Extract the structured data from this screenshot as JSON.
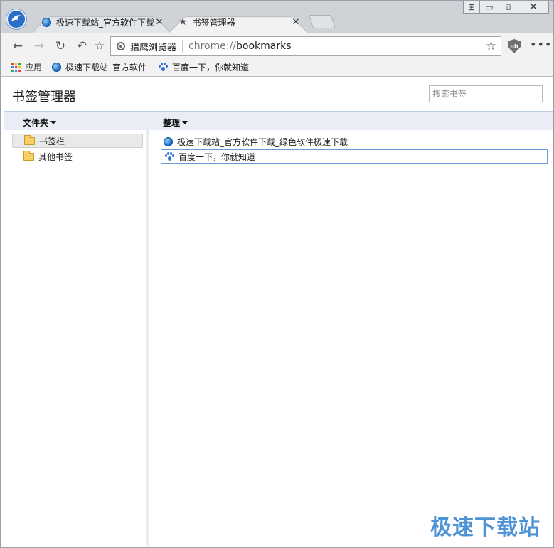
{
  "tabs": [
    {
      "title": "极速下载站_官方软件下载",
      "icon": "globe-icon",
      "active": false
    },
    {
      "title": "书签管理器",
      "icon": "star-icon",
      "active": true
    }
  ],
  "tab_close_glyph": "✕",
  "window_controls": {
    "tiles": "⊞",
    "minimize": "▭",
    "restore": "⧉",
    "close": "✕"
  },
  "toolbar": {
    "back": "←",
    "forward": "→",
    "reload": "↻",
    "undo_close": "↶",
    "favorite": "☆",
    "menu": "•••"
  },
  "omnibox": {
    "chip_label": "猎鹰浏览器",
    "url_scheme": "chrome://",
    "url_rest": "bookmarks",
    "star": "☆"
  },
  "extension_icon_text": "ub",
  "bookmarks_bar": {
    "items": [
      {
        "label": "应用",
        "icon": "apps-icon"
      },
      {
        "label": "极速下载站_官方软件",
        "icon": "globe-icon"
      },
      {
        "label": "百度一下，你就知道",
        "icon": "paw-icon"
      }
    ]
  },
  "manager": {
    "title": "书签管理器",
    "search_placeholder": "搜索书签",
    "folders_menu": "文件夹",
    "organize_menu": "整理",
    "folders": [
      {
        "label": "书签栏",
        "selected": true
      },
      {
        "label": "其他书签",
        "selected": false
      }
    ],
    "bookmarks": [
      {
        "label": "极速下载站_官方软件下载_绿色软件极速下载",
        "icon": "globe-icon",
        "focused": false
      },
      {
        "label": "百度一下，你就知道",
        "icon": "paw-icon",
        "focused": true
      }
    ]
  },
  "watermark": "极速下载站",
  "colors": {
    "accent": "#2a6fc7",
    "header_strip": "#e9eef6",
    "folder": "#f7cf64",
    "watermark": "#4e93d6"
  }
}
